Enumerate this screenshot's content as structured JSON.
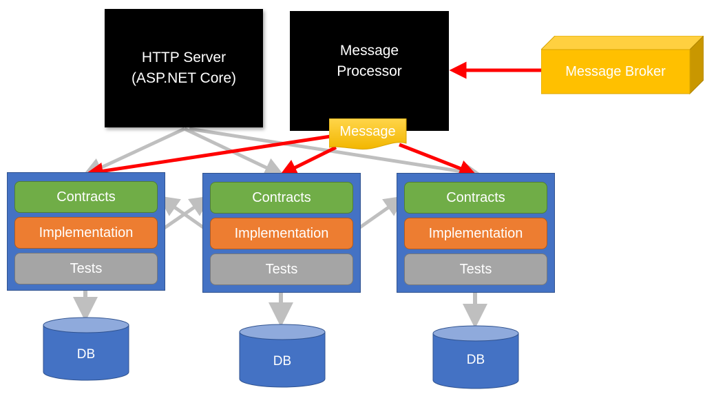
{
  "http_server": {
    "line1": "HTTP Server",
    "line2": "(ASP.NET Core)"
  },
  "message_processor": {
    "line1": "Message",
    "line2": "Processor"
  },
  "message_broker": {
    "label": "Message Broker"
  },
  "message_tag": {
    "label": "Message"
  },
  "modules": [
    {
      "contracts": "Contracts",
      "implementation": "Implementation",
      "tests": "Tests",
      "db": "DB"
    },
    {
      "contracts": "Contracts",
      "implementation": "Implementation",
      "tests": "Tests",
      "db": "DB"
    },
    {
      "contracts": "Contracts",
      "implementation": "Implementation",
      "tests": "Tests",
      "db": "DB"
    }
  ],
  "colors": {
    "module": "#4472c4",
    "contracts": "#70ad47",
    "implementation": "#ed7d31",
    "tests": "#a5a5a5",
    "broker": "#ffc000",
    "red_arrow": "#ff0000",
    "gray_arrow": "#bfbfbf"
  }
}
